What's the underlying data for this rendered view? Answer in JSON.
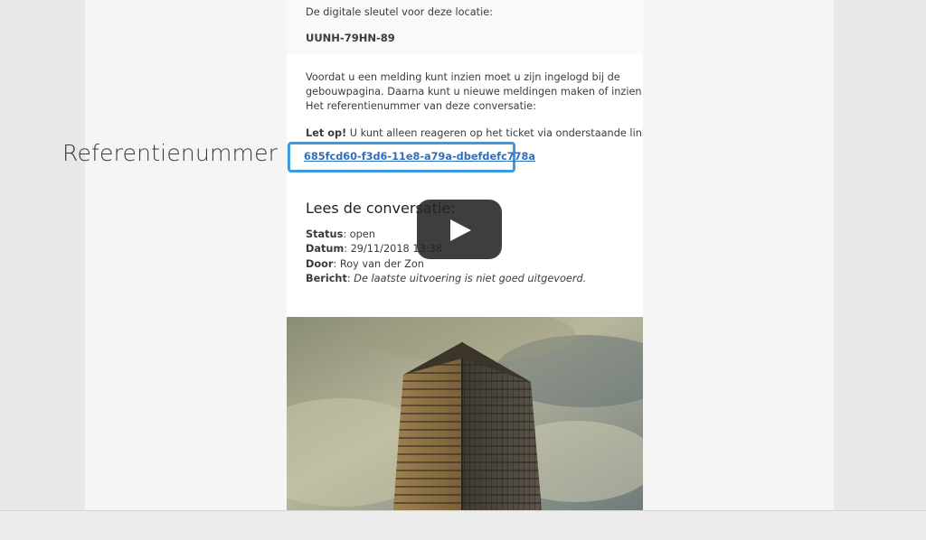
{
  "side_label": "Referentienummer",
  "email": {
    "key_label": "De digitale sleutel voor deze locatie:",
    "key_value": "UUNH-79HN-89",
    "intro_lines": [
      "Voordat u een melding kunt inzien moet u zijn ingelogd bij de",
      "gebouwpagina. Daarna kunt u nieuwe meldingen maken of inzien.",
      "Het referentienummer van deze conversatie:"
    ],
    "warning_bold": "Let op!",
    "warning_text": " U kunt alleen reageren op het ticket via onderstaande link.",
    "reference_link": "685fcd60-f3d6-11e8-a79a-dbefdefc778a",
    "conversation_heading": "Lees de conversatie:",
    "status_label": "Status",
    "status_value": ": open",
    "date_label": "Datum",
    "date_value": ": 29/11/2018 13:38",
    "author_label": "Door",
    "author_value": ": Roy van der Zon",
    "message_label": "Bericht",
    "message_value": "De laatste uitvoering is niet goed uitgevoerd."
  },
  "colors": {
    "highlight_border": "#3b9ae2",
    "link": "#2d6fc2",
    "play_button": "#232323"
  },
  "icons": {
    "play": "play-icon"
  }
}
